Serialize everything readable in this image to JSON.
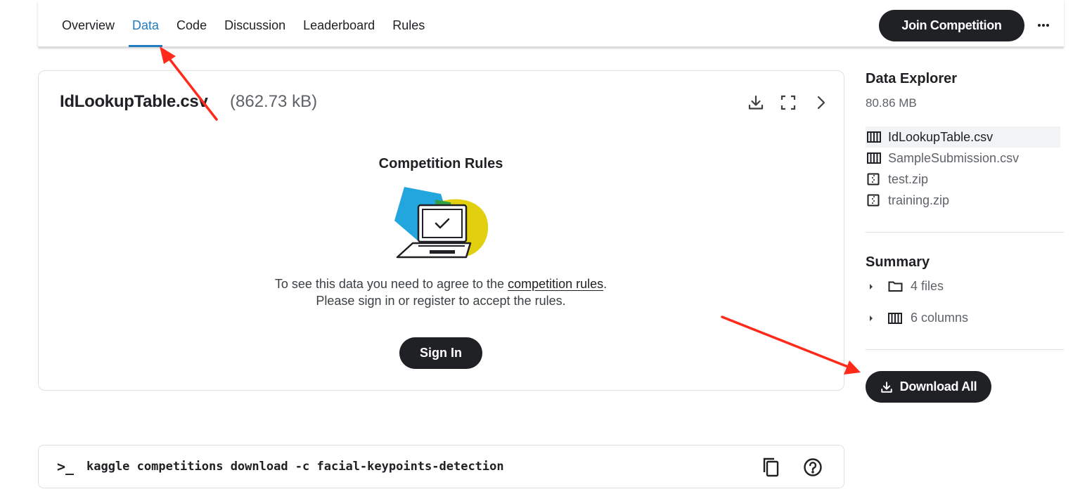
{
  "nav": {
    "tabs": [
      {
        "label": "Overview"
      },
      {
        "label": "Data",
        "active": true
      },
      {
        "label": "Code"
      },
      {
        "label": "Discussion"
      },
      {
        "label": "Leaderboard"
      },
      {
        "label": "Rules"
      }
    ],
    "join_label": "Join Competition",
    "more_icon": "more-horizontal-icon"
  },
  "card": {
    "file_name": "IdLookupTable.csv",
    "file_size": "(862.73 kB)",
    "actions": [
      "download-icon",
      "fullscreen-icon",
      "chevron-right-icon"
    ],
    "rules_title": "Competition Rules",
    "rules_text_before": "To see this data you need to agree to the ",
    "rules_link": "competition rules",
    "rules_text_after": ".",
    "rules_text_line2": "Please sign in or register to accept the rules.",
    "signin_label": "Sign In"
  },
  "command": {
    "prompt": ">_",
    "text": "kaggle competitions download -c facial-keypoints-detection"
  },
  "sidebar": {
    "explorer_title": "Data Explorer",
    "total_size": "80.86 MB",
    "files": [
      {
        "name": "IdLookupTable.csv",
        "icon": "table-icon",
        "selected": true
      },
      {
        "name": "SampleSubmission.csv",
        "icon": "table-icon"
      },
      {
        "name": "test.zip",
        "icon": "zip-icon"
      },
      {
        "name": "training.zip",
        "icon": "zip-icon"
      }
    ],
    "summary_title": "Summary",
    "summary": {
      "files": "4 files",
      "columns": "6 columns"
    },
    "download_all_label": "Download All"
  },
  "colors": {
    "primary_dark": "#202124",
    "active_tab": "#1f7cc0",
    "annotation_red": "#ff2a1a"
  }
}
